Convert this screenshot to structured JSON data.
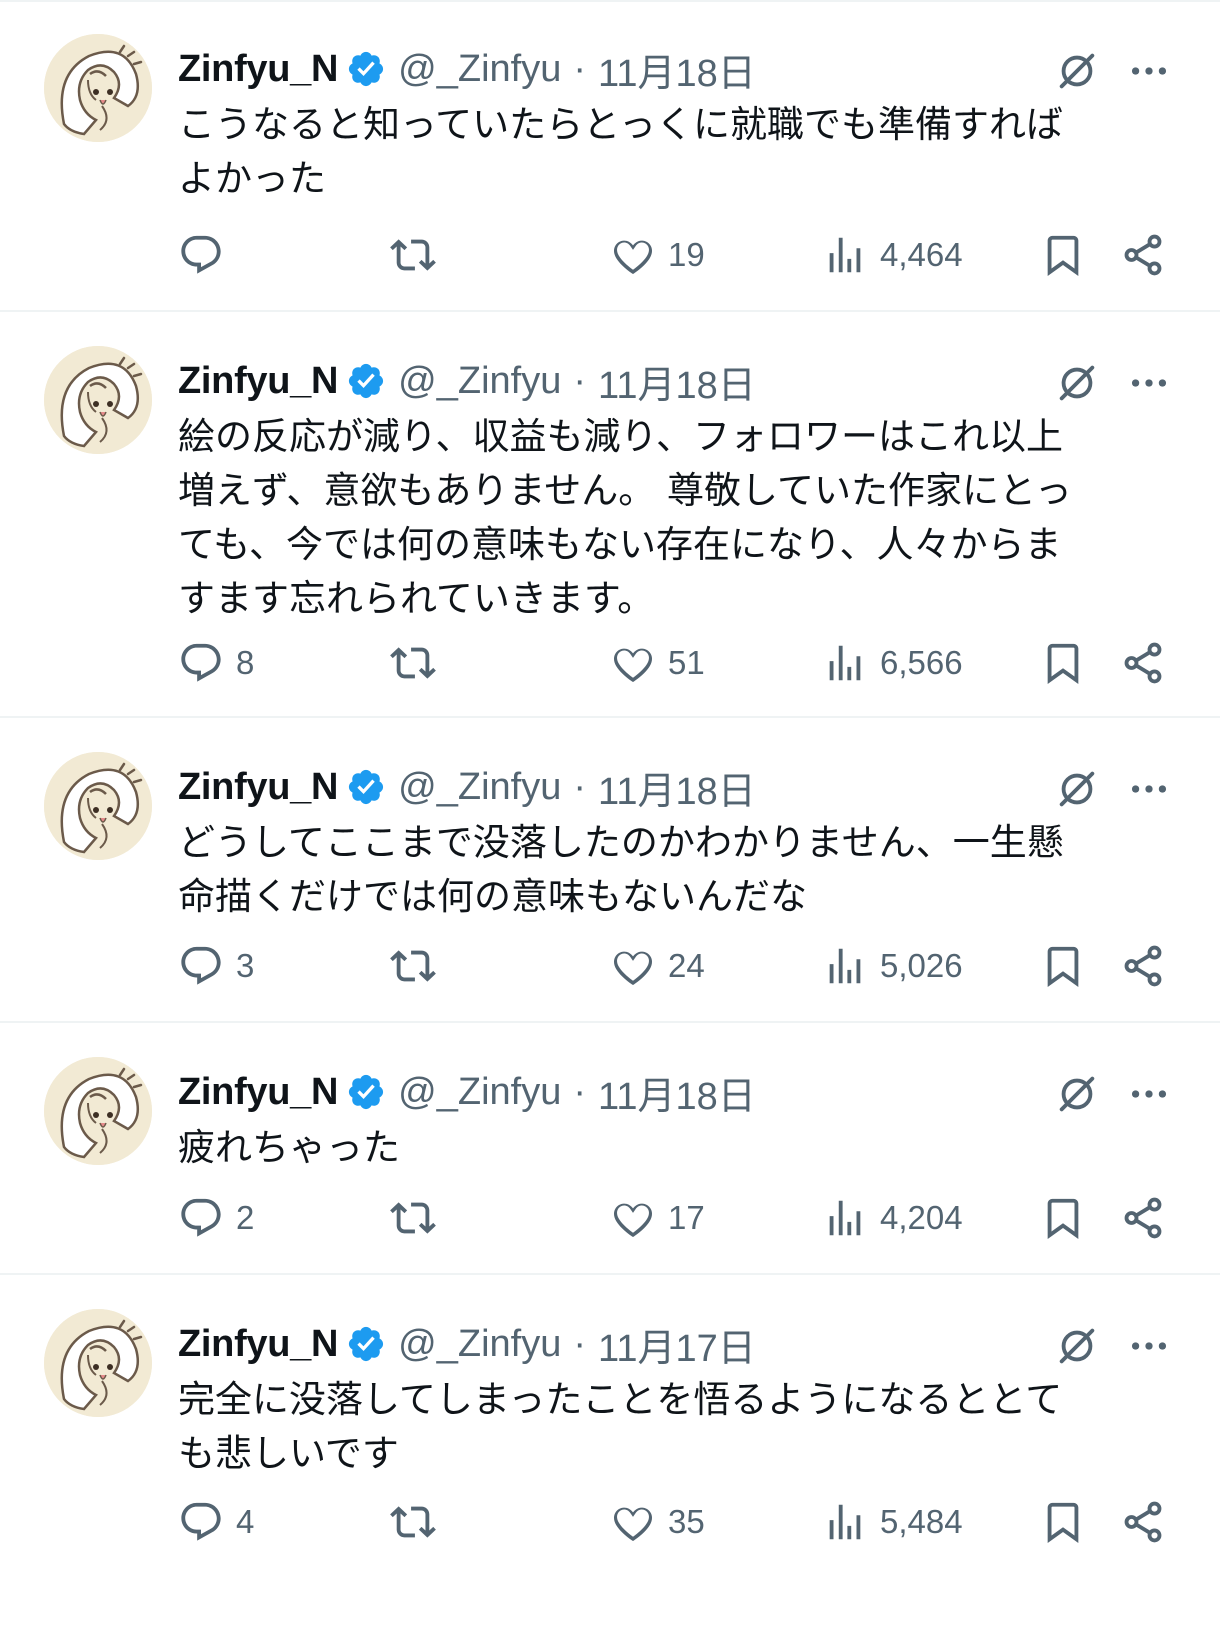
{
  "tweets": [
    {
      "name": "Zinfyu_N",
      "handle": "@_Zinfyu",
      "separator": "·",
      "date": "11月18日",
      "text": "こうなると知っていたらとっくに就職でも準備すれば\nよかった",
      "replies": "",
      "reposts": "",
      "likes": "19",
      "views": "4,464"
    },
    {
      "name": "Zinfyu_N",
      "handle": "@_Zinfyu",
      "separator": "·",
      "date": "11月18日",
      "text": "絵の反応が減り、収益も減り、フォロワーはこれ以上\n増えず、意欲もありません。 尊敬していた作家にとっ\nても、今では何の意味もない存在になり、人々からま\nすます忘れられていきます。",
      "replies": "8",
      "reposts": "",
      "likes": "51",
      "views": "6,566"
    },
    {
      "name": "Zinfyu_N",
      "handle": "@_Zinfyu",
      "separator": "·",
      "date": "11月18日",
      "text": "どうしてここまで没落したのかわかりません、一生懸\n命描くだけでは何の意味もないんだな",
      "replies": "3",
      "reposts": "",
      "likes": "24",
      "views": "5,026"
    },
    {
      "name": "Zinfyu_N",
      "handle": "@_Zinfyu",
      "separator": "·",
      "date": "11月18日",
      "text": "疲れちゃった",
      "replies": "2",
      "reposts": "",
      "likes": "17",
      "views": "4,204"
    },
    {
      "name": "Zinfyu_N",
      "handle": "@_Zinfyu",
      "separator": "·",
      "date": "11月17日",
      "text": "完全に没落してしまったことを悟るようになるととて\nも悲しいです",
      "replies": "4",
      "reposts": "",
      "likes": "35",
      "views": "5,484"
    }
  ],
  "icons": {
    "avatar": "avatar",
    "verified": "verified-badge-icon",
    "grok": "grok-icon",
    "more": "more-icon",
    "reply": "reply-icon",
    "repost": "repost-icon",
    "like": "heart-icon",
    "views": "views-icon",
    "bookmark": "bookmark-icon",
    "share": "share-icon"
  },
  "colors": {
    "text": "#0f1419",
    "secondary": "#536471",
    "verified": "#1d9bf0",
    "divider": "#eff3f4"
  }
}
